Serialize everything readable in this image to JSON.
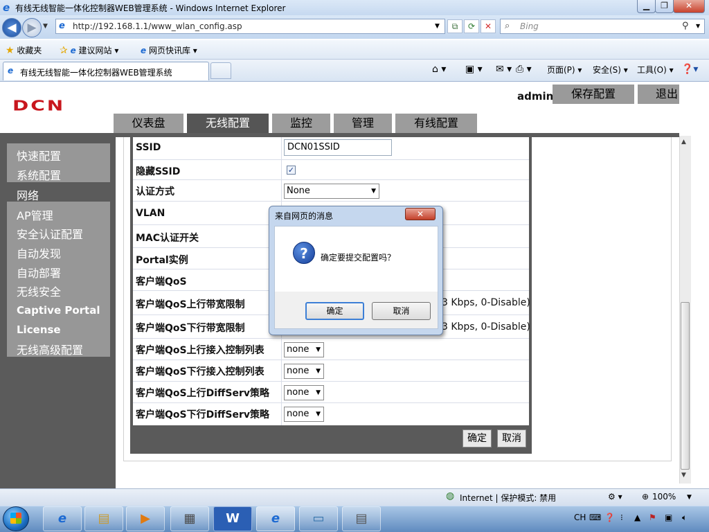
{
  "window": {
    "title": "有线无线智能一体化控制器WEB管理系统 - Windows Internet Explorer"
  },
  "address": {
    "url": "http://192.168.1.1/www_wlan_config.asp"
  },
  "search": {
    "placeholder": "Bing"
  },
  "favorites_bar": {
    "favorites": "收藏夹",
    "suggested_sites": "建议网站 ▾",
    "web_slice_gallery": "网页快讯库 ▾"
  },
  "tab": {
    "title": "有线无线智能一体化控制器WEB管理系统"
  },
  "command_bar": {
    "page": "页面(P) ▾",
    "safety": "安全(S) ▾",
    "tools": "工具(O) ▾"
  },
  "header": {
    "logo": "DCN",
    "user": "admin",
    "save_config": "保存配置",
    "logout": "退出"
  },
  "main_tabs": [
    "仪表盘",
    "无线配置",
    "监控",
    "管理",
    "有线配置"
  ],
  "active_tab": "无线配置",
  "sidebar": {
    "group1": [
      "快速配置",
      "系统配置"
    ],
    "network": "网络",
    "group2": [
      "AP管理",
      "安全认证配置",
      "自动发现",
      "自动部署",
      "无线安全",
      "Captive Portal",
      "License",
      "无线高级配置"
    ]
  },
  "form": {
    "ssid_label": "SSID",
    "ssid_value": "DCN01SSID",
    "hide_ssid_label": "隐藏SSID",
    "hide_ssid_checked": true,
    "auth_label": "认证方式",
    "auth_value": "None",
    "vlan_label": "VLAN",
    "mac_auth_label": "MAC认证开关",
    "portal_label": "Portal实例",
    "qos_label": "客户端QoS",
    "qos_up_bw_label": "客户端QoS上行带宽限制",
    "qos_up_bw_hint": "3 Kbps, 0-Disable)",
    "qos_down_bw_label": "客户端QoS下行带宽限制",
    "qos_down_bw_hint": "3 Kbps, 0-Disable)",
    "qos_up_acl_label": "客户端QoS上行接入控制列表",
    "qos_up_acl_value": "none",
    "qos_down_acl_label": "客户端QoS下行接入控制列表",
    "qos_down_acl_value": "none",
    "qos_up_diffserv_label": "客户端QoS上行DiffServ策略",
    "qos_up_diffserv_value": "none",
    "qos_down_diffserv_label": "客户端QoS下行DiffServ策略",
    "qos_down_diffserv_value": "none",
    "ok": "确定",
    "cancel": "取消"
  },
  "dialog": {
    "title": "来自网页的消息",
    "message": "确定要提交配置吗？",
    "ok": "确定",
    "cancel": "取消"
  },
  "status_bar": {
    "zone": "Internet | 保护模式: 禁用",
    "zoom": "100%"
  },
  "taskbar": {
    "lang": "CH"
  },
  "colors": {
    "logo": "#c8161d",
    "active_tab": "#555555",
    "sidebar": "#5b5b5b",
    "sidebar_group": "#979797"
  }
}
